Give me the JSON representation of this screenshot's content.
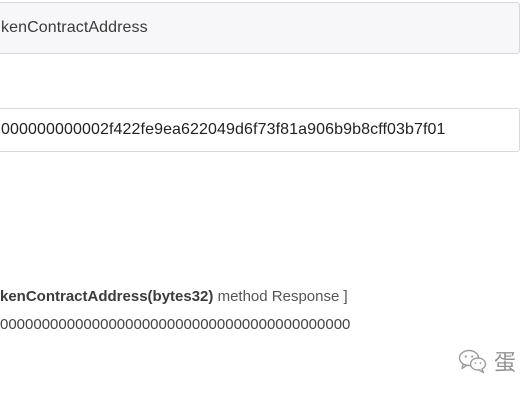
{
  "method_input": {
    "value": "kenContractAddress"
  },
  "param_input": {
    "value": "000000000002f422fe9ea622049d6f73f81a906b9b8cff03b7f01"
  },
  "response": {
    "method_signature": "kenContractAddress(bytes32)",
    "suffix": " method Response ]",
    "value": "000000000000000000000000000000000000000000"
  },
  "watermark": {
    "icon": "wechat-icon",
    "text": "蛋"
  }
}
